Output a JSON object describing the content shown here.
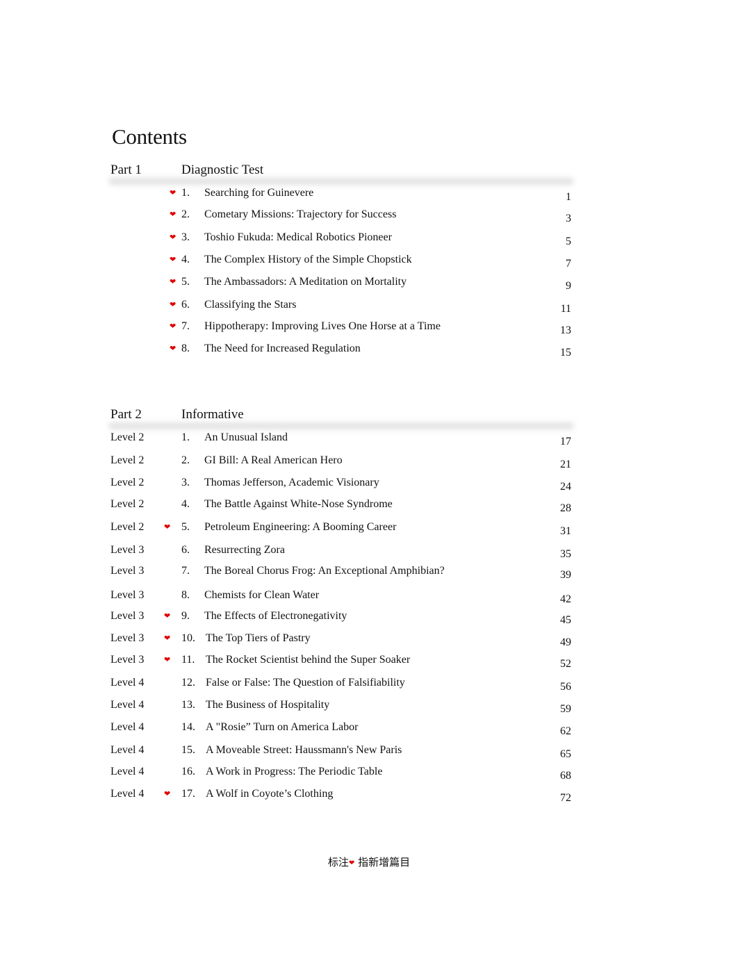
{
  "title": "Contents",
  "parts": [
    {
      "label": "Part 1",
      "name": "Diagnostic Test",
      "entries": [
        {
          "level": "",
          "new": true,
          "num": "1.",
          "title": "Searching for Guinevere",
          "page": "1"
        },
        {
          "level": "",
          "new": true,
          "num": "2.",
          "title": "Cometary Missions: Trajectory for Success",
          "page": "3"
        },
        {
          "level": "",
          "new": true,
          "num": "3.",
          "title": "Toshio Fukuda: Medical Robotics Pioneer",
          "page": "5"
        },
        {
          "level": "",
          "new": true,
          "num": "4.",
          "title": "The Complex History of the Simple Chopstick",
          "page": "7"
        },
        {
          "level": "",
          "new": true,
          "num": "5.",
          "title": "The Ambassadors: A Meditation on Mortality",
          "page": "9"
        },
        {
          "level": "",
          "new": true,
          "num": "6.",
          "title": "Classifying the Stars",
          "page": "11"
        },
        {
          "level": "",
          "new": true,
          "num": "7.",
          "title": "Hippotherapy: Improving Lives One Horse at a Time",
          "page": "13"
        },
        {
          "level": "",
          "new": true,
          "num": "8.",
          "title": "The Need for Increased Regulation",
          "page": "15"
        }
      ]
    },
    {
      "label": "Part 2",
      "name": "Informative",
      "entries": [
        {
          "level": "Level 2",
          "new": false,
          "num": "1.",
          "title": "An Unusual Island",
          "page": "17"
        },
        {
          "level": "Level 2",
          "new": false,
          "num": "2.",
          "title": "GI Bill: A Real American Hero",
          "page": "21"
        },
        {
          "level": "Level 2",
          "new": false,
          "num": "3.",
          "title": "Thomas Jefferson, Academic Visionary",
          "page": "24"
        },
        {
          "level": "Level 2",
          "new": false,
          "num": "4.",
          "title": "The Battle Against White-Nose Syndrome",
          "page": "28"
        },
        {
          "level": "Level 2",
          "new": true,
          "num": "5.",
          "title": "Petroleum Engineering: A Booming Career",
          "page": "31"
        },
        {
          "level": "Level 3",
          "new": false,
          "num": "6.",
          "title": "Resurrecting Zora",
          "page": "35"
        },
        {
          "level": "Level 3",
          "new": false,
          "num": "7.",
          "title": "The Boreal Chorus Frog: An Exceptional Amphibian?",
          "page": "39"
        },
        {
          "level": "Level 3",
          "new": false,
          "num": "8.",
          "title": "Chemists for Clean Water",
          "page": "42"
        },
        {
          "level": "Level 3",
          "new": true,
          "num": "9.",
          "title": "The Effects of Electronegativity",
          "page": "45"
        },
        {
          "level": "Level 3",
          "new": true,
          "num": "10.",
          "title": "The Top Tiers of Pastry",
          "page": "49"
        },
        {
          "level": "Level 3",
          "new": true,
          "num": "11.",
          "title": "The Rocket Scientist behind the Super Soaker",
          "page": "52"
        },
        {
          "level": "Level 4",
          "new": false,
          "num": "12.",
          "title": "False or False: The Question of Falsifiability",
          "page": "56"
        },
        {
          "level": "Level 4",
          "new": false,
          "num": "13.",
          "title": "The Business of Hospitality",
          "page": "59"
        },
        {
          "level": "Level 4",
          "new": false,
          "num": "14.",
          "title": "A \"Rosie” Turn on America Labor",
          "page": "62"
        },
        {
          "level": "Level 4",
          "new": false,
          "num": "15.",
          "title": "A Moveable Street: Haussmann's New Paris",
          "page": "65"
        },
        {
          "level": "Level 4",
          "new": false,
          "num": "16.",
          "title": "A Work in Progress: The Periodic Table",
          "page": "68"
        },
        {
          "level": "Level 4",
          "new": true,
          "num": "17.",
          "title": "A Wolf in Coyote’s Clothing",
          "page": "72"
        }
      ]
    }
  ],
  "icons": {
    "new_marker": "heart-icon",
    "new_marker_glyph": "❤"
  },
  "colors": {
    "new_marker": "#e00000",
    "text": "#111111"
  },
  "footnote": {
    "before": "标注",
    "after": " 指新增篇目"
  }
}
